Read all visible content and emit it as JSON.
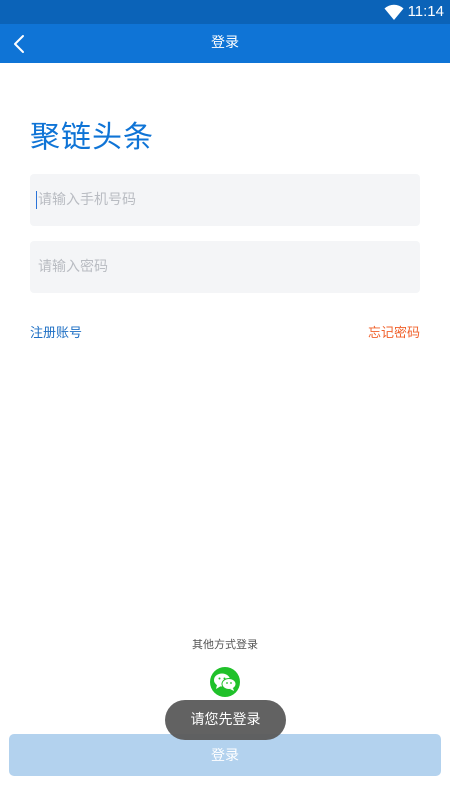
{
  "status_bar": {
    "time": "11:14",
    "wifi_icon": "wifi-icon"
  },
  "header": {
    "title": "登录",
    "back_icon": "chevron-left-icon"
  },
  "brand": {
    "name": "聚链头条"
  },
  "form": {
    "phone_placeholder": "请输入手机号码",
    "password_placeholder": "请输入密码",
    "phone_value": "",
    "password_value": ""
  },
  "links": {
    "register": "注册账号",
    "forgot": "忘记密码"
  },
  "social": {
    "label": "其他方式登录",
    "wechat_icon": "wechat-icon"
  },
  "toast": {
    "message": "请您先登录"
  },
  "login_button": {
    "label": "登录"
  },
  "colors": {
    "status_bar": "#0b63b8",
    "header": "#0f74d6",
    "brand": "#0f74d6",
    "register_link": "#1e6fc4",
    "forgot_link": "#f0602a",
    "wechat": "#20c12a",
    "login_button": "#b3d2ee",
    "toast": "#5d5d5d"
  }
}
